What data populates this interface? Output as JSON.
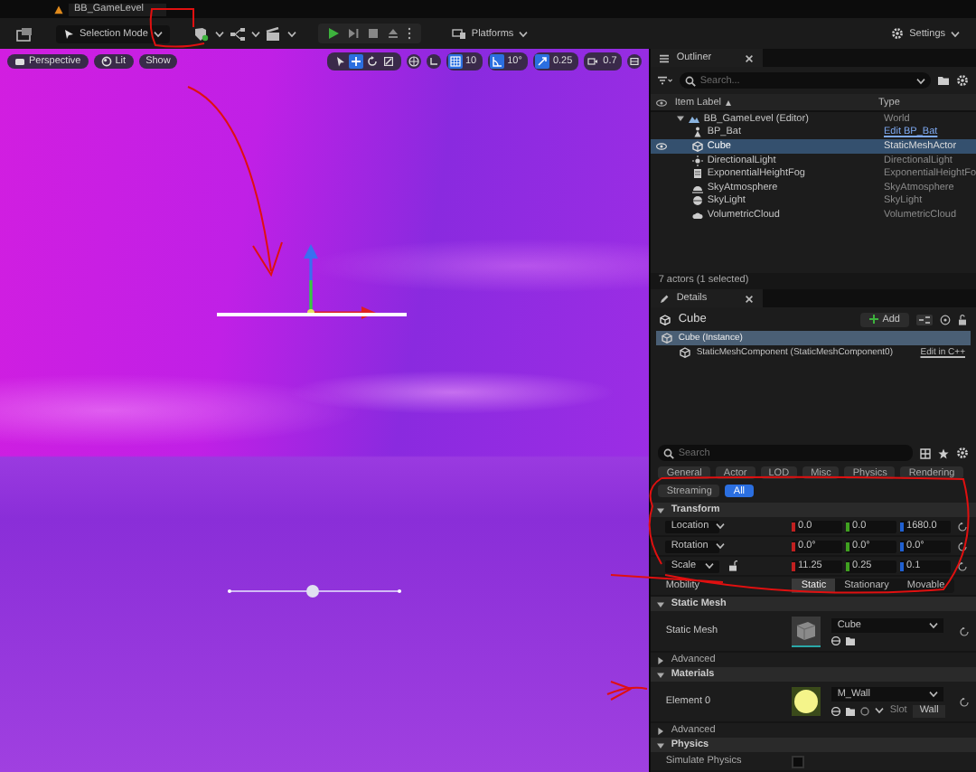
{
  "title_tab": {
    "label": "BB_GameLevel"
  },
  "toolbar": {
    "mode_button": "Selection Mode",
    "platforms_button": "Platforms",
    "settings_button": "Settings"
  },
  "viewport": {
    "view_buttons": [
      {
        "kind": "perspective",
        "label": "Perspective"
      },
      {
        "kind": "lit",
        "label": "Lit"
      },
      {
        "kind": "show",
        "label": "Show"
      }
    ],
    "transform_tools": [
      {
        "kind": "select",
        "selected": false
      },
      {
        "kind": "translate",
        "selected": true
      },
      {
        "kind": "rotate",
        "selected": false
      },
      {
        "kind": "scale",
        "selected": false
      }
    ],
    "snaps": [
      {
        "kind": "grid",
        "value": "10",
        "on": true
      },
      {
        "kind": "rotation",
        "value": "10°",
        "on": true
      },
      {
        "kind": "scale",
        "value": "0.25",
        "on": true
      },
      {
        "kind": "camera",
        "value": "0.7",
        "on": false
      }
    ]
  },
  "outliner": {
    "tab": "Outliner",
    "search_placeholder": "Search...",
    "columns": [
      "Item Label",
      "Type"
    ],
    "rows": [
      {
        "kind": "world",
        "label": "BB_GameLevel (Editor)",
        "type": "World",
        "selected": false,
        "expanded": true,
        "children": [
          {
            "kind": "blueprint",
            "label": "BP_Bat",
            "type": "Edit BP_Bat",
            "selected": false
          },
          {
            "kind": "mesh",
            "label": "Cube",
            "type": "StaticMeshActor",
            "selected": true
          },
          {
            "kind": "light",
            "label": "DirectionalLight",
            "type": "DirectionalLight",
            "selected": false
          },
          {
            "kind": "fog",
            "label": "ExponentialHeightFog",
            "type": "ExponentialHeightFo",
            "selected": false
          },
          {
            "kind": "atmosphere",
            "label": "SkyAtmosphere",
            "type": "SkyAtmosphere",
            "selected": false
          },
          {
            "kind": "skylight",
            "label": "SkyLight",
            "type": "SkyLight",
            "selected": false
          },
          {
            "kind": "cloud",
            "label": "VolumetricCloud",
            "type": "VolumetricCloud",
            "selected": false
          }
        ]
      }
    ],
    "footer": "7 actors (1 selected)"
  },
  "details": {
    "tab": "Details",
    "actor": "Cube",
    "add_button": "Add",
    "components": [
      {
        "label": "Cube (Instance)",
        "selected": true,
        "children": [
          {
            "label": "StaticMeshComponent (StaticMeshComponent0)",
            "link": "Edit in C++",
            "selected": false
          }
        ]
      }
    ],
    "search_placeholder": "Search",
    "filters": [
      {
        "label": "General",
        "selected": false
      },
      {
        "label": "Actor",
        "selected": false
      },
      {
        "label": "LOD",
        "selected": false
      },
      {
        "label": "Misc",
        "selected": false
      },
      {
        "label": "Physics",
        "selected": false
      },
      {
        "label": "Rendering",
        "selected": false
      },
      {
        "label": "Streaming",
        "selected": false
      },
      {
        "label": "All",
        "selected": true
      }
    ],
    "sections": [
      {
        "kind": "category",
        "title": "Transform",
        "expanded": true,
        "rows": [
          {
            "kind": "vector",
            "label": "Location",
            "values": [
              "0.0",
              "0.0",
              "1680.0"
            ]
          },
          {
            "kind": "vector",
            "label": "Rotation",
            "values": [
              "0.0°",
              "0.0°",
              "0.0°"
            ]
          },
          {
            "kind": "vector",
            "label": "Scale",
            "values": [
              "11.25",
              "0.25",
              "0.1"
            ],
            "locked": false
          },
          {
            "kind": "choice",
            "label": "Mobility",
            "options": [
              {
                "label": "Static",
                "selected": true
              },
              {
                "label": "Stationary",
                "selected": false
              },
              {
                "label": "Movable",
                "selected": false
              }
            ]
          }
        ]
      },
      {
        "kind": "category",
        "title": "Static Mesh",
        "expanded": true,
        "rows": [
          {
            "kind": "asset",
            "label": "Static Mesh",
            "asset": "Cube"
          }
        ]
      },
      {
        "kind": "advanced",
        "title": "Advanced",
        "expanded": false
      },
      {
        "kind": "category",
        "title": "Materials",
        "expanded": true,
        "rows": [
          {
            "kind": "material",
            "label": "Element 0",
            "asset": "M_Wall",
            "slot_label": "Slot",
            "slot": "Wall"
          }
        ]
      },
      {
        "kind": "advanced",
        "title": "Advanced",
        "expanded": false
      },
      {
        "kind": "category",
        "title": "Physics",
        "expanded": true,
        "rows": [
          {
            "kind": "checkbox",
            "label": "Simulate Physics",
            "checked": false
          }
        ]
      }
    ]
  }
}
